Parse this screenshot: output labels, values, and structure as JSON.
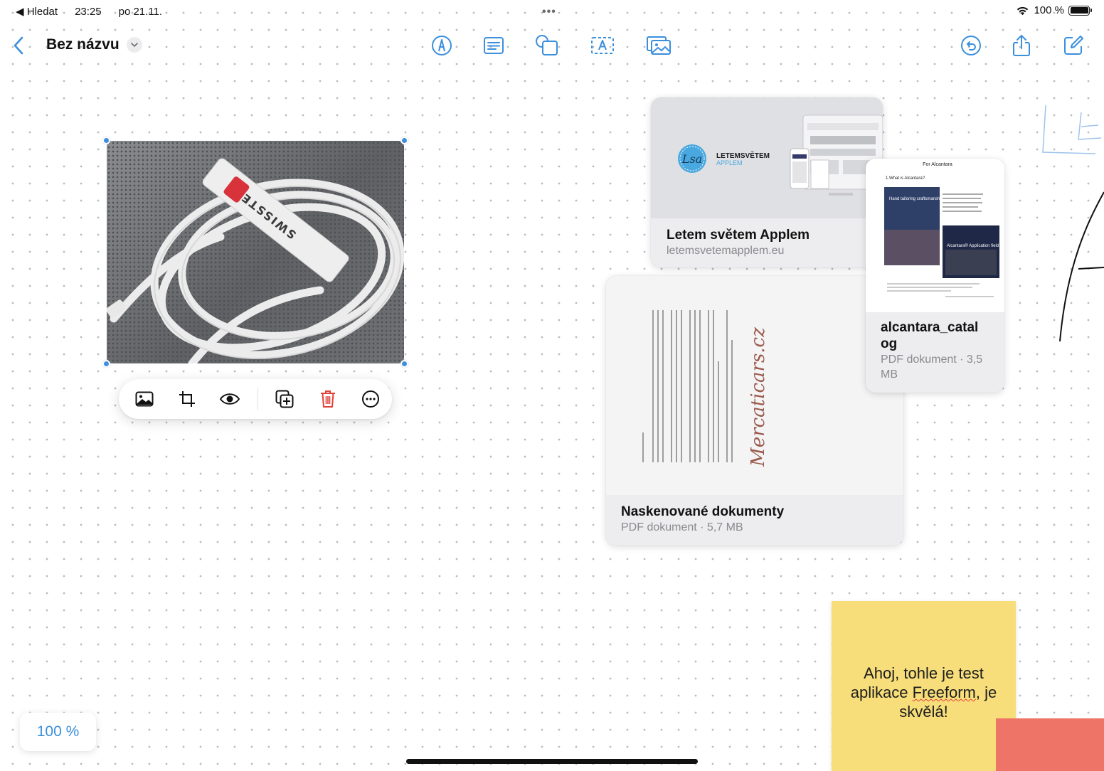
{
  "status_bar": {
    "back_app": "◀ Hledat",
    "time": "23:25",
    "date": "po 21.11.",
    "multitask_dots": "•••",
    "battery": "100 %"
  },
  "navbar": {
    "title": "Bez názvu"
  },
  "link_card": {
    "title": "Letem světem Applem",
    "url": "letemsvetemapplem.eu",
    "logo_text": "LETEMSVĚTEM",
    "logo_sub": "APPLEM",
    "logo_mark": "Lsa"
  },
  "scan_card": {
    "title": "Naskenované dokumenty",
    "meta": "PDF dokument · 5,7 MB",
    "watermark": "Mercaticars.cz"
  },
  "pdf_card": {
    "title": "alcantara_catal og",
    "meta": "PDF dokument · 3,5 MB",
    "preview_header": "For Alcantara",
    "preview_q": "1.What is Alcantara?",
    "preview_img1": "Hand tailoring craftsmanship",
    "preview_img2": "Alcantara® Application field"
  },
  "photo": {
    "label_text": "SWISSTEN"
  },
  "sticky_note": {
    "text_before": "Ahoj, tohle je test aplikace ",
    "text_underlined": "Freeform",
    "text_after": ", je skvělá!"
  },
  "zoom": {
    "level": "100 %"
  },
  "colors": {
    "accent": "#3b8fdc",
    "sticky_yellow": "#f7de7a",
    "sticky_red": "#ee7468",
    "delete_red": "#e0433a"
  },
  "icons": {
    "toolbar": [
      "pen-icon",
      "text-box-icon",
      "shapes-icon",
      "text-icon",
      "media-icon"
    ],
    "right": [
      "undo-icon",
      "share-icon",
      "compose-icon"
    ],
    "image_toolbar": [
      "replace-image-icon",
      "crop-icon",
      "eye-icon",
      "duplicate-icon",
      "trash-icon",
      "more-icon"
    ]
  }
}
